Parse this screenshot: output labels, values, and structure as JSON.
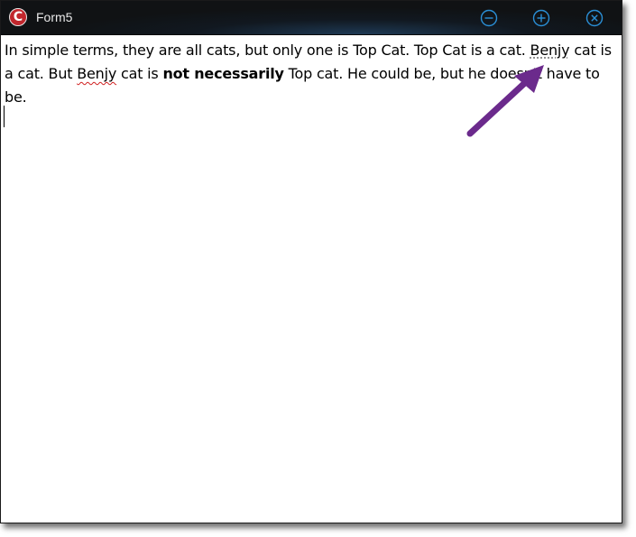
{
  "window": {
    "title": "Form5",
    "app_icon_letter": "C",
    "buttons": {
      "minimize_icon": "minus-circle-icon",
      "maximize_icon": "plus-circle-icon",
      "close_icon": "x-circle-icon"
    },
    "accent_color": "#2a8fd6"
  },
  "document": {
    "line1": {
      "text": "In simple terms, they are all cats, but only one is Top Cat. Top Cat is a cat. ",
      "marked_word": "Benjy",
      "after": " cat is"
    },
    "line2": {
      "start": "a cat. But ",
      "misspelled_word": "Benjy",
      "middle": " cat is ",
      "bold": "not necessarily",
      "end": " Top cat. He could be, but he doesn't have to be."
    }
  },
  "annotation": {
    "type": "arrow",
    "color": "#6b2a8c",
    "target": "Benjy"
  }
}
